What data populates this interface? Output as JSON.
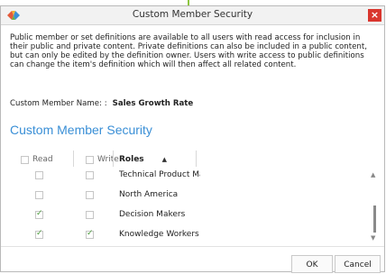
{
  "dialog": {
    "title": "Custom Member Security",
    "close_label": "×",
    "description": "Public member or set definitions are available to all users with read access for inclusion in their public and private content. Private definitions can also be included in a public content, but can only be edited by the definition owner. Users with write access to public definitions can change the item's definition which will then affect all related content.",
    "name_label": "Custom Member Name: :",
    "name_value": "Sales Growth Rate",
    "section_title": "Custom Member Security"
  },
  "table": {
    "headers": {
      "read": "Read",
      "write": "Write",
      "roles": "Roles"
    },
    "rows": [
      {
        "role": "Technical Product Ma",
        "read": false,
        "write": false
      },
      {
        "role": "North America",
        "read": false,
        "write": false
      },
      {
        "role": "Decision Makers",
        "read": true,
        "write": false
      },
      {
        "role": "Knowledge Workers",
        "read": true,
        "write": true
      }
    ]
  },
  "buttons": {
    "ok": "OK",
    "cancel": "Cancel"
  },
  "colors": {
    "accent": "#3a8fd6",
    "close": "#d9362e",
    "check": "#4a9a3a"
  }
}
